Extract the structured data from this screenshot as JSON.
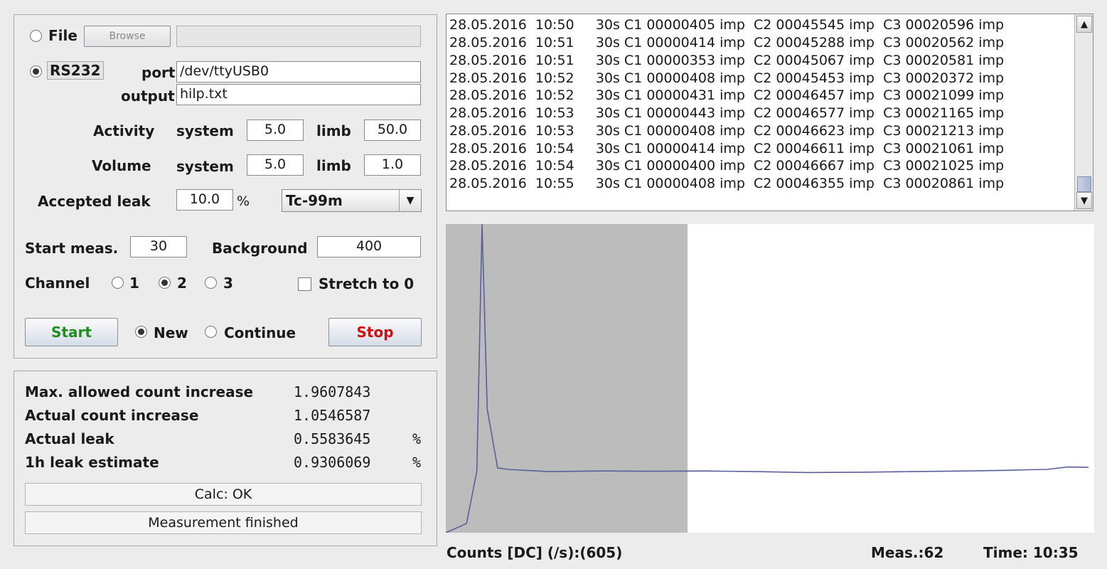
{
  "source": {
    "file_label": "File",
    "browse_label": "Browse",
    "file_path": "",
    "rs232_label": "RS232",
    "port_label": "port",
    "port_value": "/dev/ttyUSB0",
    "output_label": "output",
    "output_value": "hilp.txt"
  },
  "activity": {
    "label": "Activity",
    "system_label": "system",
    "system_value": "5.0",
    "limb_label": "limb",
    "limb_value": "50.0"
  },
  "volume": {
    "label": "Volume",
    "system_label": "system",
    "system_value": "5.0",
    "limb_label": "limb",
    "limb_value": "1.0"
  },
  "leak": {
    "label": "Accepted leak",
    "value": "10.0",
    "unit": "%",
    "isotope": "Tc-99m"
  },
  "start_meas": {
    "label": "Start meas.",
    "value": "30"
  },
  "background": {
    "label": "Background",
    "value": "400"
  },
  "channel": {
    "label": "Channel",
    "options": [
      "1",
      "2",
      "3"
    ],
    "selected": "2",
    "stretch_label": "Stretch to 0"
  },
  "controls": {
    "start_label": "Start",
    "new_label": "New",
    "continue_label": "Continue",
    "stop_label": "Stop",
    "start_color": "#1e8f1e",
    "stop_color": "#d01010"
  },
  "results": {
    "rows": [
      {
        "label": "Max. allowed count increase",
        "value": "1.9607843",
        "unit": ""
      },
      {
        "label": "Actual count increase",
        "value": "1.0546587",
        "unit": ""
      },
      {
        "label": "Actual leak",
        "value": "0.5583645",
        "unit": "%"
      },
      {
        "label": "1h leak estimate",
        "value": "0.9306069",
        "unit": "%"
      }
    ],
    "calc_status": "Calc: OK",
    "measurement_status": "Measurement finished"
  },
  "log": {
    "lines": [
      "28.05.2016  10:50     30s C1 00000405 imp  C2 00045545 imp  C3 00020596 imp",
      "28.05.2016  10:51     30s C1 00000414 imp  C2 00045288 imp  C3 00020562 imp",
      "28.05.2016  10:51     30s C1 00000353 imp  C2 00045067 imp  C3 00020581 imp",
      "28.05.2016  10:52     30s C1 00000408 imp  C2 00045453 imp  C3 00020372 imp",
      "28.05.2016  10:52     30s C1 00000431 imp  C2 00046457 imp  C3 00021099 imp",
      "28.05.2016  10:53     30s C1 00000443 imp  C2 00046577 imp  C3 00021165 imp",
      "28.05.2016  10:53     30s C1 00000408 imp  C2 00046623 imp  C3 00021213 imp",
      "28.05.2016  10:54     30s C1 00000414 imp  C2 00046611 imp  C3 00021061 imp",
      "28.05.2016  10:54     30s C1 00000400 imp  C2 00046667 imp  C3 00021025 imp",
      "28.05.2016  10:55     30s C1 00000408 imp  C2 00046355 imp  C3 00020861 imp"
    ]
  },
  "footer": {
    "counts_text": "Counts [DC] (/s):(605)",
    "meas_text": "Meas.:62",
    "time_text": "Time: 10:35"
  },
  "chart_data": {
    "type": "line",
    "title": "",
    "xlabel": "",
    "ylabel": "",
    "grid": false,
    "start_region_measurements": 30,
    "series": [
      {
        "color": "#5a5f9c",
        "x": [
          0,
          2,
          3,
          3.5,
          4,
          5,
          6,
          10,
          15,
          20,
          25,
          30,
          35,
          40,
          45,
          50,
          54,
          56,
          58,
          60,
          62
        ],
        "values": [
          0,
          3,
          20,
          100,
          40,
          21,
          20.5,
          19.8,
          20,
          19.9,
          20,
          19.8,
          19.5,
          19.6,
          19.8,
          20,
          20.2,
          20.4,
          20.5,
          21.3,
          21.2
        ]
      }
    ]
  }
}
